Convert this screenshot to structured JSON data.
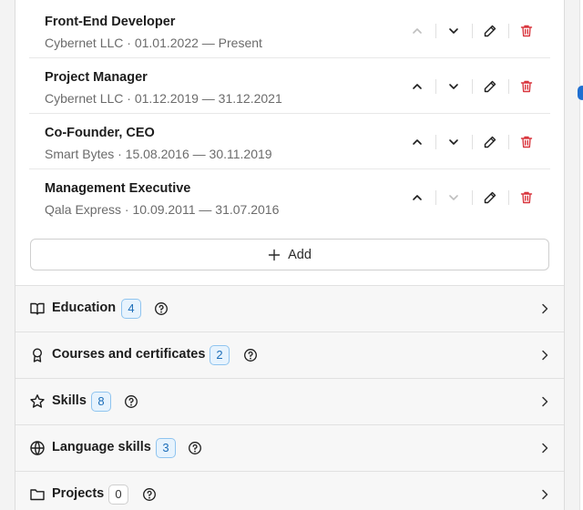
{
  "experience": {
    "items": [
      {
        "title": "Front-End Developer",
        "subtitle": "Cybernet LLC · 01.01.2022 — Present",
        "up_disabled": true,
        "down_disabled": false
      },
      {
        "title": "Project Manager",
        "subtitle": "Cybernet LLC · 01.12.2019 — 31.12.2021",
        "up_disabled": false,
        "down_disabled": false
      },
      {
        "title": "Co-Founder, CEO",
        "subtitle": "Smart Bytes · 15.08.2016 — 30.11.2019",
        "up_disabled": false,
        "down_disabled": false
      },
      {
        "title": "Management Executive",
        "subtitle": "Qala Express · 10.09.2011 — 31.07.2016",
        "up_disabled": false,
        "down_disabled": true
      }
    ],
    "add_label": "Add"
  },
  "sections": [
    {
      "label": "Education",
      "count": "4",
      "icon": "book-icon"
    },
    {
      "label": "Courses and certificates",
      "count": "2",
      "icon": "award-icon"
    },
    {
      "label": "Skills",
      "count": "8",
      "icon": "star-icon"
    },
    {
      "label": "Language skills",
      "count": "3",
      "icon": "globe-icon"
    },
    {
      "label": "Projects",
      "count": "0",
      "icon": "folder-icon"
    }
  ],
  "colors": {
    "accent_blue": "#1c6db8",
    "delete_red": "#d9363e",
    "badge_bg": "#e7f3fd",
    "badge_border": "#8fc4ef"
  }
}
